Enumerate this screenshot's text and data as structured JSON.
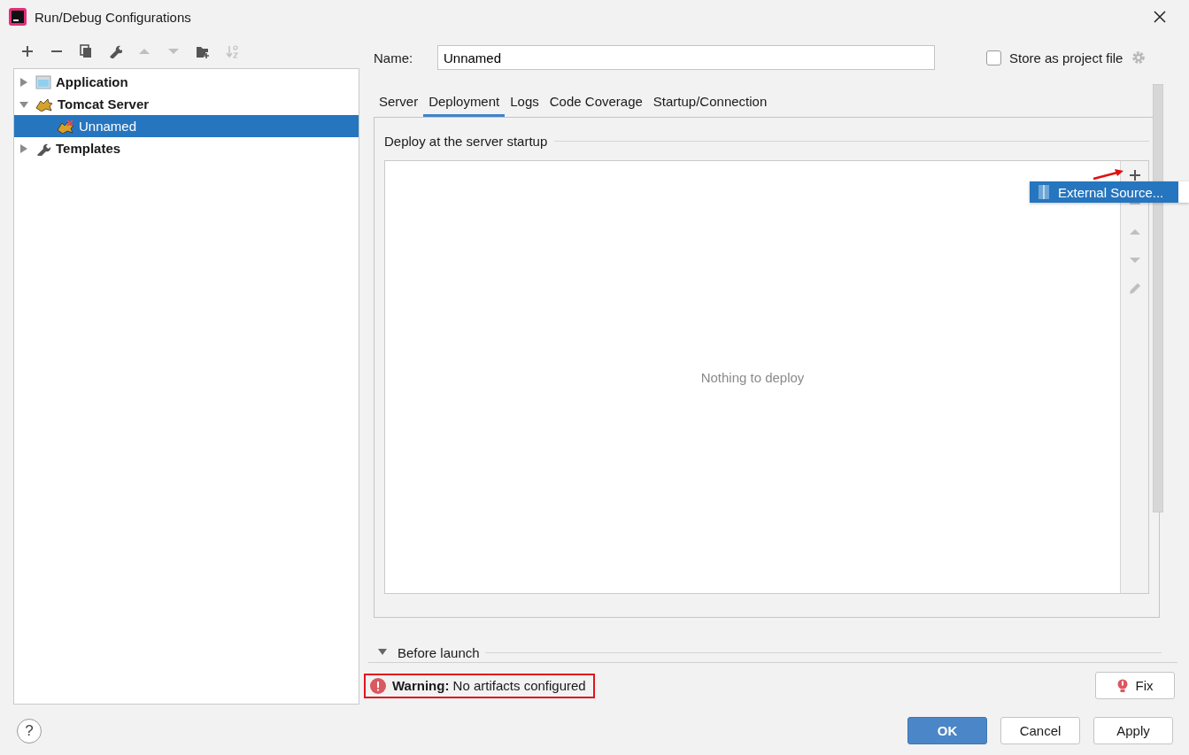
{
  "window": {
    "title": "Run/Debug Configurations"
  },
  "toolbar": [
    {
      "kind": "add",
      "disabled": false
    },
    {
      "kind": "remove",
      "disabled": false
    },
    {
      "kind": "copy",
      "disabled": false
    },
    {
      "kind": "wrench",
      "disabled": false
    },
    {
      "kind": "up",
      "disabled": true
    },
    {
      "kind": "down",
      "disabled": true
    },
    {
      "kind": "folder",
      "disabled": false
    },
    {
      "kind": "sort",
      "disabled": true
    }
  ],
  "tree": [
    {
      "label": "Application",
      "kind": "application",
      "expanded": false,
      "selected": false
    },
    {
      "label": "Tomcat Server",
      "kind": "tomcat",
      "expanded": true,
      "selected": false,
      "children": [
        {
          "label": "Unnamed",
          "kind": "tomcat-error",
          "selected": true
        }
      ]
    },
    {
      "label": "Templates",
      "kind": "wrench",
      "expanded": false,
      "selected": false
    }
  ],
  "name_field": {
    "label": "Name:",
    "value": "Unnamed"
  },
  "store_checkbox": {
    "label": "Store as project file",
    "checked": false
  },
  "tabs": [
    {
      "label": "Server",
      "selected": false
    },
    {
      "label": "Deployment",
      "selected": true
    },
    {
      "label": "Logs",
      "selected": false
    },
    {
      "label": "Code Coverage",
      "selected": false
    },
    {
      "label": "Startup/Connection",
      "selected": false
    }
  ],
  "deploy": {
    "title": "Deploy at the server startup",
    "empty_text": "Nothing to deploy",
    "side_toolbar": [
      {
        "kind": "add",
        "disabled": false
      },
      {
        "kind": "remove",
        "disabled": true
      },
      {
        "kind": "up",
        "disabled": true
      },
      {
        "kind": "down",
        "disabled": true
      },
      {
        "kind": "edit",
        "disabled": true
      }
    ]
  },
  "popup_menu": [
    {
      "label": "External Source...",
      "selected": true
    }
  ],
  "before_launch": {
    "label": "Before launch",
    "expanded": true
  },
  "warning": {
    "text": "**Warning:** No artifacts configured"
  },
  "fix_button": "Fix",
  "help_button": "?",
  "buttons": [
    {
      "label": "OK",
      "kind": "primary"
    },
    {
      "label": "Cancel",
      "kind": "normal"
    },
    {
      "label": "Apply",
      "kind": "normal"
    }
  ]
}
